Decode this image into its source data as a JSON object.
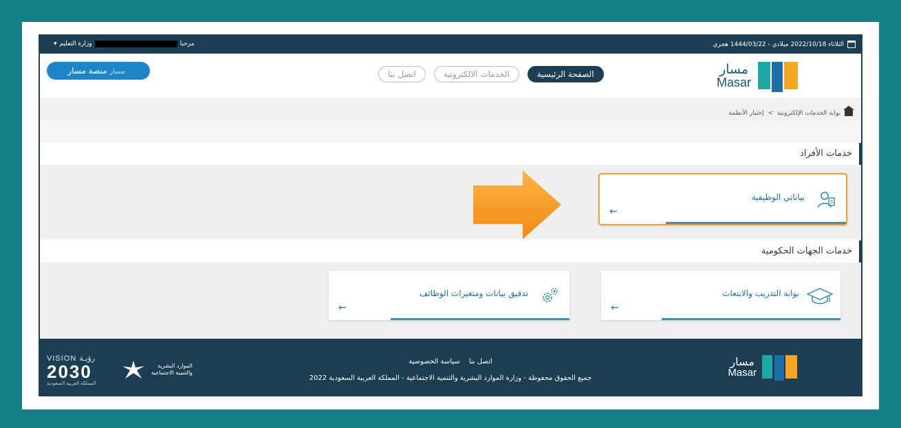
{
  "topbar": {
    "date": "الثلاثاء 2022/10/18 ميلادي - 1444/03/22 هجري",
    "welcome": "مرحبا",
    "org": "وزارة التعليم",
    "calendar_icon": "calendar-icon",
    "dropdown_icon": "chevron-down-icon"
  },
  "header": {
    "logo_ar": "مسار",
    "logo_en": "Masar",
    "nav": [
      "الصفحة الرئيسية",
      "الخدمات الالكترونية",
      "اتصل بنا"
    ],
    "platform_button": "منصة مسار",
    "platform_tag": "مسار"
  },
  "breadcrumb": {
    "portal": "بوابة الخدمات الإلكترونية",
    "separator": ">",
    "current": "إختيار الأنظمة"
  },
  "sections": {
    "individuals": {
      "title": "خدمات الأفراد",
      "cards": [
        {
          "title": "بياناتي الوظيفية",
          "icon": "user-profile-icon"
        }
      ]
    },
    "government": {
      "title": "خدمات الجهات الحكومية",
      "cards": [
        {
          "title": "بوابة التدريب والابتعاث",
          "icon": "graduation-cap-icon"
        },
        {
          "title": "تدقيق بيانات ومتغيرات الوظائف",
          "icon": "gears-icon"
        }
      ]
    }
  },
  "footer": {
    "links": [
      "اتصل بنا",
      "سياسة الخصوصية"
    ],
    "copyright": "جميع الحقوق محفوظة - وزارة الموارد البشرية والتنمية الاجتماعية - المملكة العربية السعودية 2022",
    "logo_ar": "مسار",
    "logo_en": "Masar",
    "ministry_line1": "الموارد البشرية",
    "ministry_line2": "والتنمية الاجتماعية",
    "vision_label": "VISION رؤيـة",
    "vision_year": "2030",
    "vision_kingdom": "المملكة العربية السعودية"
  },
  "colors": {
    "background": "#177f86",
    "navy": "#1c3d52",
    "accent_blue": "#1e86c8",
    "highlight": "#f0a030"
  }
}
